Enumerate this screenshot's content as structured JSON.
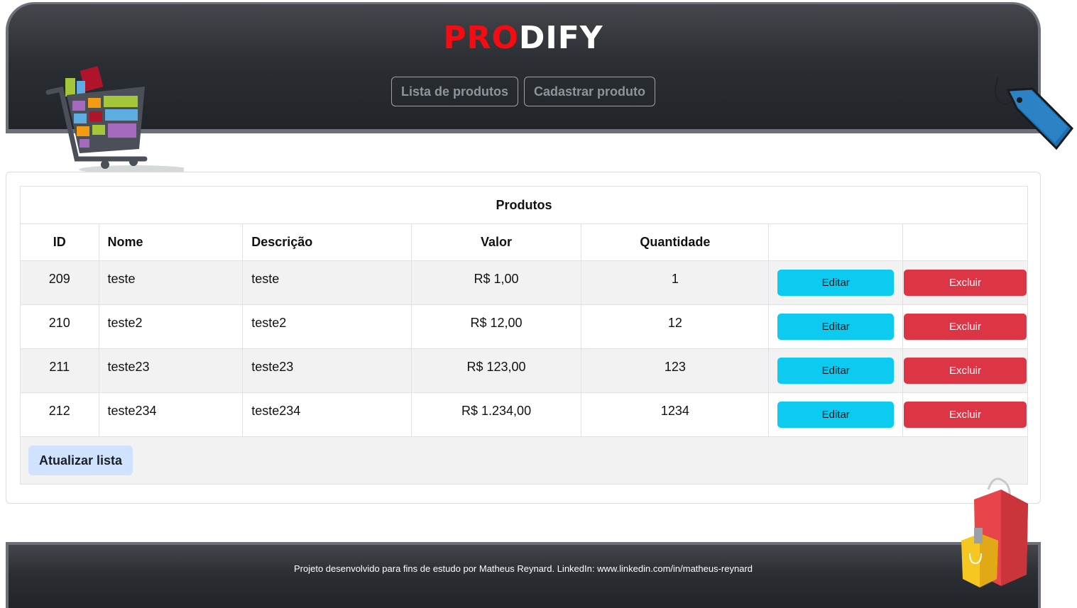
{
  "brand": {
    "part1": "PRO",
    "part2": "DIFY"
  },
  "nav": {
    "list_label": "Lista de produtos",
    "create_label": "Cadastrar produto"
  },
  "table": {
    "caption": "Produtos",
    "headers": {
      "id": "ID",
      "name": "Nome",
      "description": "Descrição",
      "value": "Valor",
      "quantity": "Quantidade"
    },
    "rows": [
      {
        "id": "209",
        "name": "teste",
        "description": "teste",
        "value": "R$ 1,00",
        "quantity": "1"
      },
      {
        "id": "210",
        "name": "teste2",
        "description": "teste2",
        "value": "R$ 12,00",
        "quantity": "12"
      },
      {
        "id": "211",
        "name": "teste23",
        "description": "teste23",
        "value": "R$ 123,00",
        "quantity": "123"
      },
      {
        "id": "212",
        "name": "teste234",
        "description": "teste234",
        "value": "R$ 1.234,00",
        "quantity": "1234"
      }
    ],
    "edit_label": "Editar",
    "delete_label": "Excluir",
    "refresh_label": "Atualizar lista"
  },
  "footer": {
    "text": "Projeto desenvolvido para fins de estudo por Matheus Reynard. LinkedIn: www.linkedin.com/in/matheus-reynard"
  },
  "colors": {
    "brand_red": "#f40c12",
    "edit": "#0dcaf0",
    "delete": "#dc3545",
    "refresh": "#cfe2ff",
    "header_dark": "#212529"
  },
  "icons": {
    "cart": "shopping-cart-icon",
    "tag": "price-tag-icon",
    "bag": "shopping-bag-icon"
  }
}
